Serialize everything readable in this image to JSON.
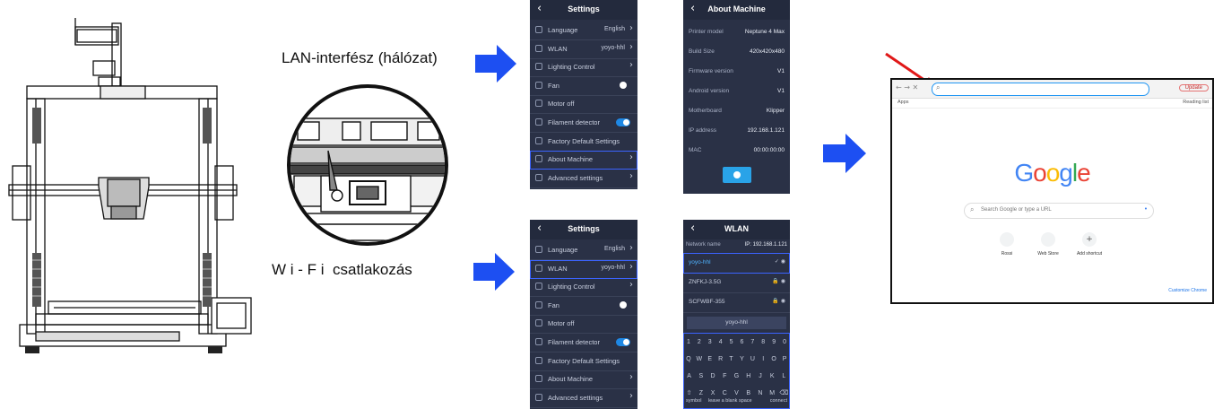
{
  "labels": {
    "lan": "LAN-interfész (hálózat)",
    "wifi": "W i - F i  csatlakozás"
  },
  "settings_screen": {
    "title": "Settings",
    "items": [
      {
        "label": "Language",
        "value": "English",
        "icon": "globe-icon",
        "control": "chevron"
      },
      {
        "label": "WLAN",
        "value": "yoyo-hhl",
        "icon": "wifi-icon",
        "control": "chevron"
      },
      {
        "label": "Lighting Control",
        "value": "",
        "icon": "light-icon",
        "control": "chevron"
      },
      {
        "label": "Fan",
        "value": "",
        "icon": "fan-icon",
        "control": "dot"
      },
      {
        "label": "Motor off",
        "value": "",
        "icon": "motor-icon",
        "control": "none"
      },
      {
        "label": "Filament detector",
        "value": "",
        "icon": "filament-icon",
        "control": "toggle"
      },
      {
        "label": "Factory Default Settings",
        "value": "",
        "icon": "reset-icon",
        "control": "none"
      },
      {
        "label": "About Machine",
        "value": "",
        "icon": "info-icon",
        "control": "chevron"
      },
      {
        "label": "Advanced settings",
        "value": "",
        "icon": "advanced-icon",
        "control": "chevron"
      }
    ]
  },
  "about_screen": {
    "title": "About Machine",
    "rows": [
      {
        "k": "Printer model",
        "v": "Neptune 4 Max"
      },
      {
        "k": "Build Size",
        "v": "420x420x480"
      },
      {
        "k": "Firmware version",
        "v": "V1"
      },
      {
        "k": "Android version",
        "v": "V1"
      },
      {
        "k": "Motherboard",
        "v": "Klipper"
      },
      {
        "k": "IP address",
        "v": "192.168.1.121"
      },
      {
        "k": "MAC",
        "v": "00:00:00:00"
      }
    ]
  },
  "wlan_screen": {
    "title": "WLAN",
    "network_label": "Network name",
    "ip": "IP: 192.168.1.121",
    "networks": [
      "yoyo-hhl",
      "ZNFKJ-3.5G",
      "SCFWBF-355"
    ],
    "password": "yoyo-hhl",
    "key_rows": [
      [
        "1",
        "2",
        "3",
        "4",
        "5",
        "6",
        "7",
        "8",
        "9",
        "0"
      ],
      [
        "Q",
        "W",
        "E",
        "R",
        "T",
        "Y",
        "U",
        "I",
        "O",
        "P"
      ],
      [
        "A",
        "S",
        "D",
        "F",
        "G",
        "H",
        "J",
        "K",
        "L"
      ],
      [
        "⇧",
        "Z",
        "X",
        "C",
        "V",
        "B",
        "N",
        "M",
        "⌫"
      ]
    ],
    "bottom": {
      "symbol": "symbol",
      "space": "leave a blank space",
      "connect": "connect"
    }
  },
  "browser": {
    "search_placeholder": "Search Google or type a URL",
    "logo": "Google",
    "shortcuts": [
      "Rossi",
      "Web Store",
      "Add shortcut"
    ],
    "update": "Update",
    "reading_list": "Reading list",
    "apps": "Apps",
    "customize": "Customize Chrome"
  },
  "colors": {
    "arrow": "#1d4ff2",
    "pointer": "#e01818",
    "screen_bg": "#2a3146",
    "highlight": "#3b63ff"
  }
}
